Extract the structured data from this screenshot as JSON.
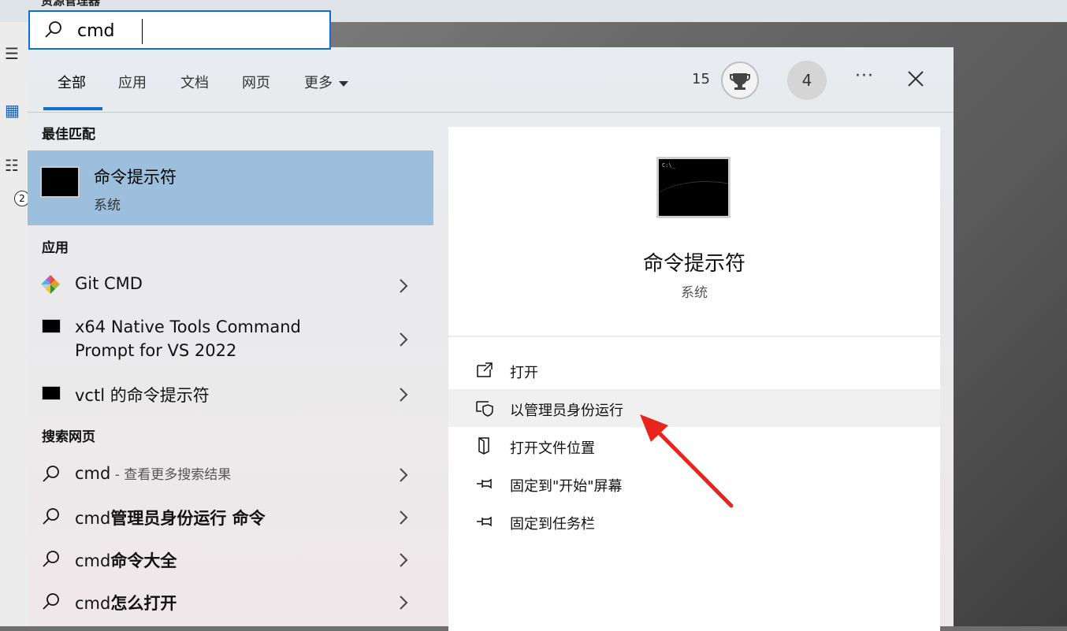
{
  "window": {
    "title": "资源管理器"
  },
  "search": {
    "value": "cmd"
  },
  "tabs": [
    {
      "label": "全部",
      "active": true
    },
    {
      "label": "应用"
    },
    {
      "label": "文档"
    },
    {
      "label": "网页"
    },
    {
      "label": "更多"
    }
  ],
  "header": {
    "points": "15",
    "badge_count": "4",
    "more_label": "···"
  },
  "sections": {
    "best_match": "最佳匹配",
    "apps": "应用",
    "web": "搜索网页"
  },
  "best_match": {
    "title": "命令提示符",
    "subtitle": "系统"
  },
  "apps": [
    {
      "line1": "Git CMD",
      "line2": ""
    },
    {
      "line1": "x64 Native Tools Command",
      "line2": "Prompt for VS 2022"
    },
    {
      "line1": "vctl 的命令提示符",
      "line2": ""
    }
  ],
  "web": [
    {
      "query": "cmd",
      "suffix": "",
      "hint": " - 查看更多搜索结果"
    },
    {
      "query": "cmd",
      "suffix": "管理员身份运行 命令",
      "hint": ""
    },
    {
      "query": "cmd",
      "suffix": "命令大全",
      "hint": ""
    },
    {
      "query": "cmd",
      "suffix": "怎么打开",
      "hint": ""
    }
  ],
  "detail": {
    "title": "命令提示符",
    "subtitle": "系统",
    "icon_text": "C:\\_",
    "actions": [
      {
        "label": "打开"
      },
      {
        "label": "以管理员身份运行"
      },
      {
        "label": "打开文件位置"
      },
      {
        "label": "固定到\"开始\"屏幕"
      },
      {
        "label": "固定到任务栏"
      }
    ]
  },
  "colors": {
    "accent": "#0f6fd4",
    "selection": "#9bbfdc",
    "arrow": "#e8241c"
  }
}
